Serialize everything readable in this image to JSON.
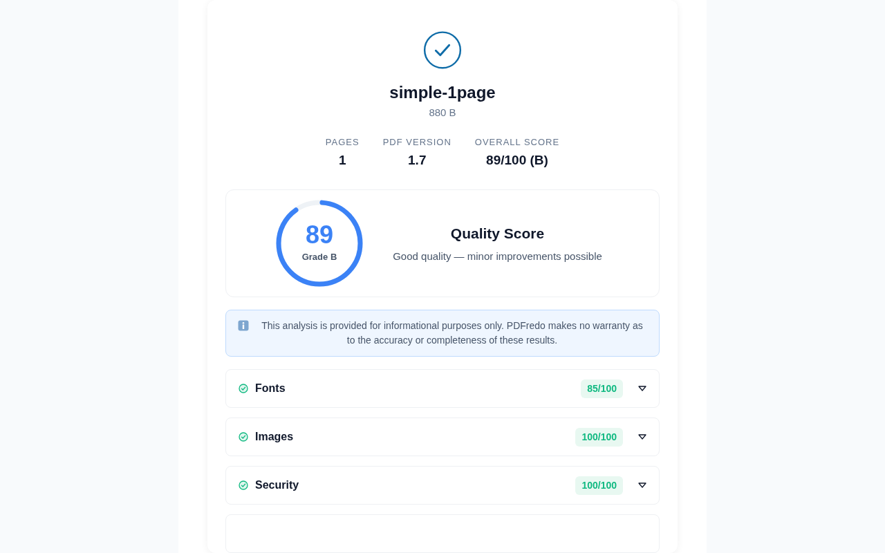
{
  "file": {
    "name": "simple-1page",
    "size": "880 B"
  },
  "stats": [
    {
      "label": "PAGES",
      "value": "1"
    },
    {
      "label": "PDF VERSION",
      "value": "1.7"
    },
    {
      "label": "OVERALL SCORE",
      "value": "89/100 (B)"
    }
  ],
  "quality": {
    "score": "89",
    "grade": "Grade B",
    "level": 0.89,
    "title": "Quality Score",
    "description": "Good quality — minor improvements possible"
  },
  "notice": "This analysis is provided for informational purposes only. PDFredo makes no warranty as to the accuracy or completeness of these results.",
  "sections": [
    {
      "title": "Fonts",
      "score": "85/100",
      "kind": "pass",
      "expanded": false
    },
    {
      "title": "Images",
      "score": "100/100",
      "kind": "pass",
      "expanded": false
    },
    {
      "title": "Security",
      "score": "100/100",
      "kind": "pass",
      "expanded": false
    }
  ]
}
